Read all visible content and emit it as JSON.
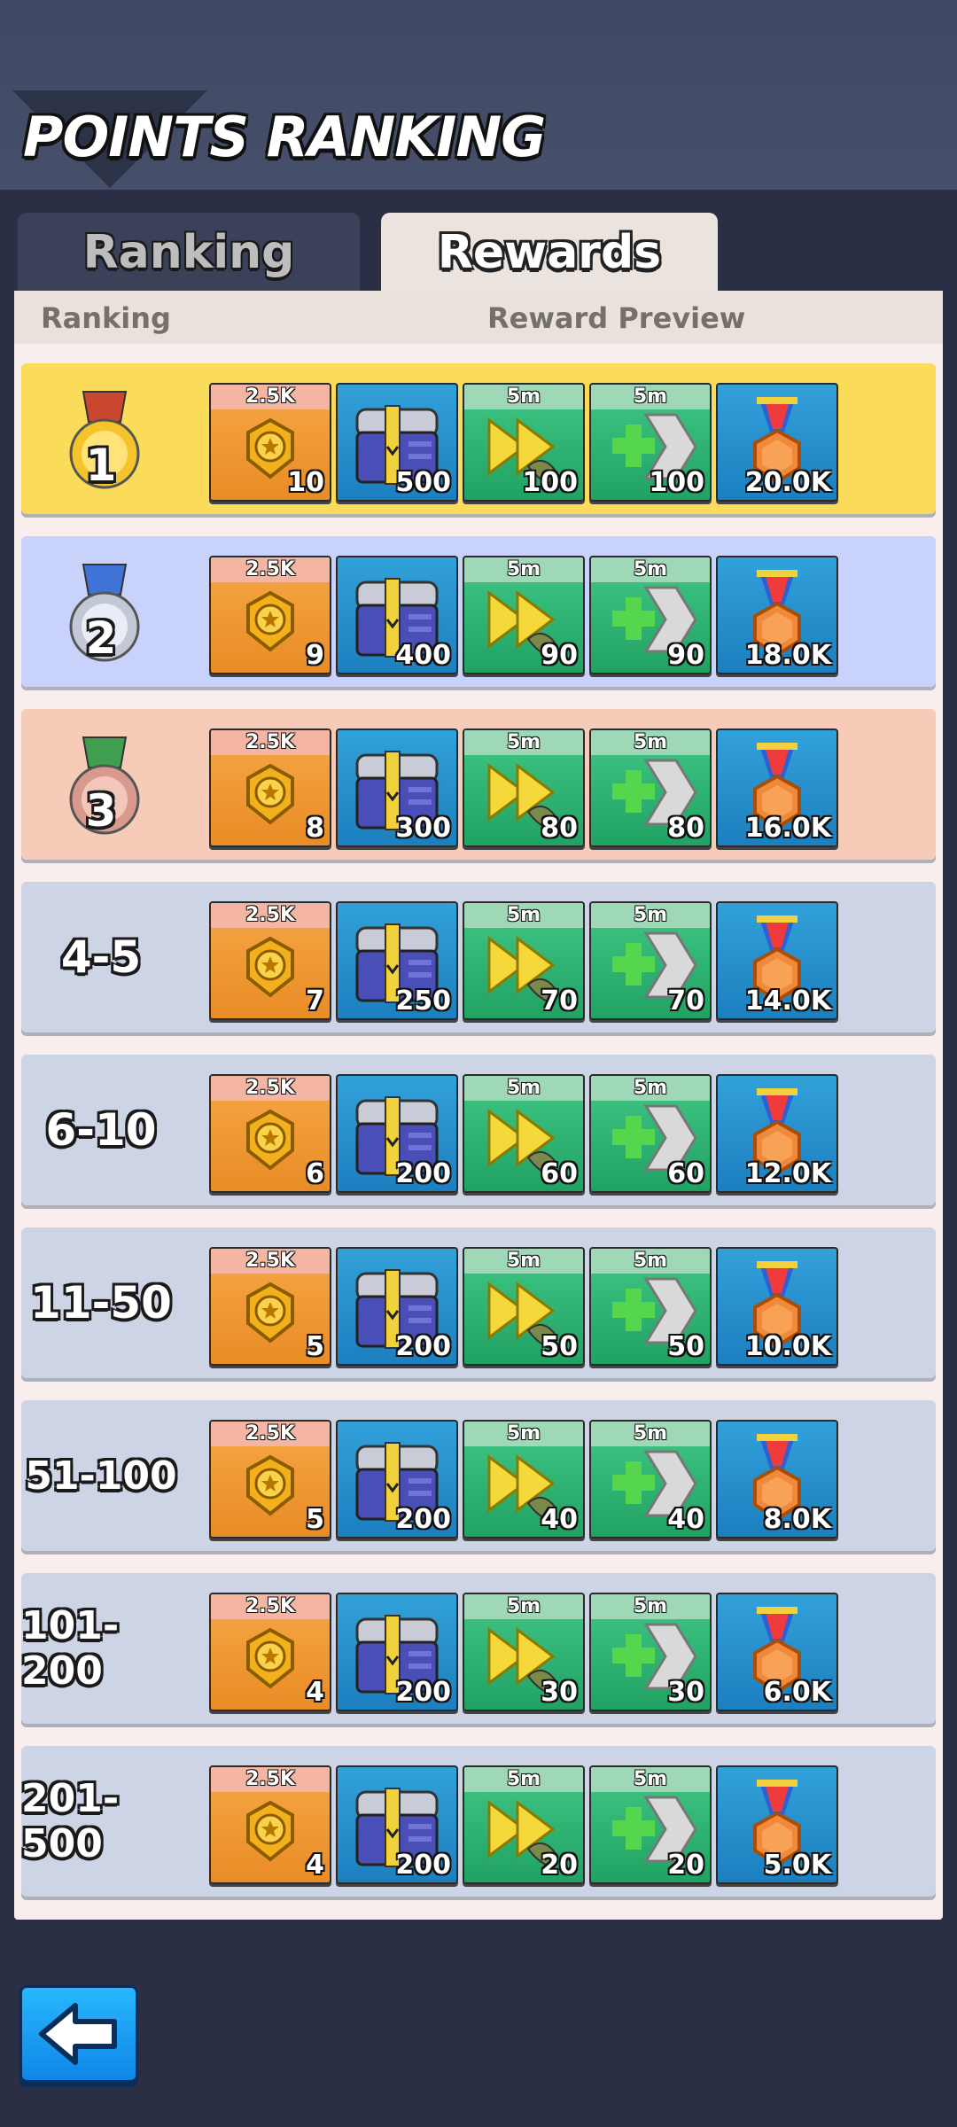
{
  "header": {
    "title": "POINTS RANKING"
  },
  "tabs": [
    {
      "label": "Ranking",
      "active": false
    },
    {
      "label": "Rewards",
      "active": true
    }
  ],
  "columns": {
    "ranking": "Ranking",
    "preview": "Reward Preview"
  },
  "item_tags": {
    "badge": "2.5K",
    "speed": "5m",
    "heal": "5m"
  },
  "rows": [
    {
      "rank": "1",
      "style": "gold",
      "rewards": [
        "10",
        "500",
        "100",
        "100",
        "20.0K"
      ]
    },
    {
      "rank": "2",
      "style": "silver",
      "rewards": [
        "9",
        "400",
        "90",
        "90",
        "18.0K"
      ]
    },
    {
      "rank": "3",
      "style": "bronze",
      "rewards": [
        "8",
        "300",
        "80",
        "80",
        "16.0K"
      ]
    },
    {
      "rank": "4-5",
      "style": "plain",
      "rewards": [
        "7",
        "250",
        "70",
        "70",
        "14.0K"
      ]
    },
    {
      "rank": "6-10",
      "style": "plain",
      "rewards": [
        "6",
        "200",
        "60",
        "60",
        "12.0K"
      ]
    },
    {
      "rank": "11-50",
      "style": "plain",
      "rewards": [
        "5",
        "200",
        "50",
        "50",
        "10.0K"
      ]
    },
    {
      "rank": "51-100",
      "style": "plain",
      "rewards": [
        "5",
        "200",
        "40",
        "40",
        "8.0K"
      ]
    },
    {
      "rank": "101-200",
      "style": "plain",
      "rewards": [
        "4",
        "200",
        "30",
        "30",
        "6.0K"
      ]
    },
    {
      "rank": "201-500",
      "style": "plain",
      "rewards": [
        "4",
        "200",
        "20",
        "20",
        "5.0K"
      ]
    }
  ],
  "colors": {
    "gold_row": "#fbdc5a",
    "silver_row": "#c8d2fb",
    "bronze_row": "#f6cbb8",
    "plain_row": "#cdd4e6"
  },
  "icons": {
    "back": "back-arrow-icon",
    "badge": "badge-icon",
    "chest": "chest-icon",
    "speed": "speedup-icon",
    "heal": "heal-icon",
    "medal": "medal-icon"
  }
}
